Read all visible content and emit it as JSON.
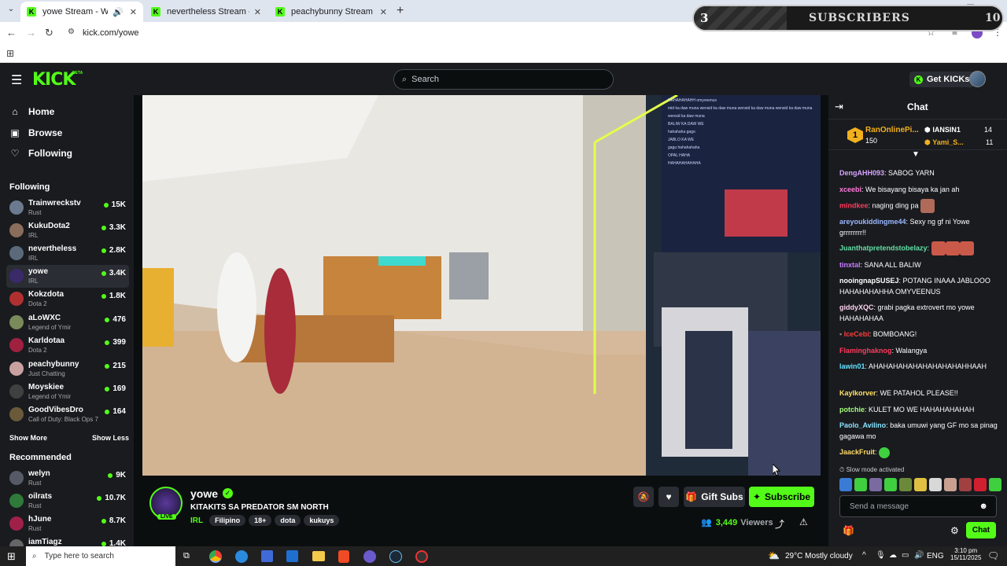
{
  "browser": {
    "tabs": [
      {
        "title": "yowe Stream - Watch Live o",
        "active": true
      },
      {
        "title": "nevertheless Stream - Watch Li",
        "active": false
      },
      {
        "title": "peachybunny Stream - Watch Li",
        "active": false
      }
    ],
    "url": "kick.com/yowe"
  },
  "overlay": {
    "count": "3",
    "label": "SUBSCRIBERS",
    "goal": "10",
    "progress": 0.3
  },
  "header": {
    "logo": "KICK",
    "beta": "BETA",
    "search_placeholder": "Search",
    "get_kicks": "Get KICKs"
  },
  "sidebar": {
    "nav": [
      {
        "label": "Home",
        "icon": "home-icon"
      },
      {
        "label": "Browse",
        "icon": "browse-icon"
      },
      {
        "label": "Following",
        "icon": "heart-icon"
      }
    ],
    "following_title": "Following",
    "following": [
      {
        "name": "Trainwreckstv",
        "game": "Rust",
        "viewers": "15K",
        "color": "#6b7a8f"
      },
      {
        "name": "KukuDota2",
        "game": "IRL",
        "viewers": "3.3K",
        "color": "#8a6d5a"
      },
      {
        "name": "nevertheless",
        "game": "IRL",
        "viewers": "2.8K",
        "color": "#5a6a7a"
      },
      {
        "name": "yowe",
        "game": "IRL",
        "viewers": "3.4K",
        "color": "#3a2a6a"
      },
      {
        "name": "Kokzdota",
        "game": "Dota 2",
        "viewers": "1.8K",
        "color": "#b03030"
      },
      {
        "name": "aLoWXC",
        "game": "Legend of Ymir",
        "viewers": "476",
        "color": "#7a8a5a"
      },
      {
        "name": "Karldotaa",
        "game": "Dota 2",
        "viewers": "399",
        "color": "#a02040"
      },
      {
        "name": "peachybunny",
        "game": "Just Chatting",
        "viewers": "215",
        "color": "#c9a0a0"
      },
      {
        "name": "Moyskiee",
        "game": "Legend of Ymir",
        "viewers": "169",
        "color": "#404040"
      },
      {
        "name": "GoodVibesDro",
        "game": "Call of Duty: Black Ops 7",
        "viewers": "164",
        "color": "#6a5a3a"
      }
    ],
    "show_more": "Show More",
    "show_less": "Show Less",
    "recommended_title": "Recommended",
    "recommended": [
      {
        "name": "welyn",
        "game": "Rust",
        "viewers": "9K",
        "color": "#555a66"
      },
      {
        "name": "oilrats",
        "game": "Rust",
        "viewers": "10.7K",
        "color": "#2f7a3a"
      },
      {
        "name": "hJune",
        "game": "Rust",
        "viewers": "8.7K",
        "color": "#a0204a"
      },
      {
        "name": "iamTiagz",
        "game": "",
        "viewers": "1.4K",
        "color": "#666"
      }
    ]
  },
  "stream": {
    "streamer": "yowe",
    "live": "LIVE",
    "title": "KITAKITS SA PREDATOR SM NORTH",
    "category": "IRL",
    "tags": [
      "Filipino",
      "18+",
      "dota",
      "kukuys"
    ],
    "gift_subs": "Gift Subs",
    "subscribe": "Subscribe",
    "viewers": "3,449",
    "viewers_label": "Viewers"
  },
  "chat": {
    "title": "Chat",
    "leaderboard": [
      {
        "rank": "1",
        "name": "RanOnlinePi...",
        "value": "150"
      },
      {
        "name": "IANSIN1",
        "value": "14"
      },
      {
        "name": "Yami_S...",
        "value": "11"
      }
    ],
    "messages": [
      {
        "user": "DengAHH093",
        "color": "#d8a5ff",
        "text": ": SABOG YARN"
      },
      {
        "user": "xceebi",
        "color": "#ff7ad9",
        "text": ": We bisayang bisaya ka jan ah"
      },
      {
        "user": "mindkee",
        "color": "#ff3b5c",
        "text": ": naging ding pa"
      },
      {
        "user": "areyoukiddingme44",
        "color": "#9bb7ff",
        "text": ": Sexy ng gf ni Yowe grrrrrrrr!!"
      },
      {
        "user": "Juanthatpretendstobelazy",
        "color": "#63e0a6",
        "text": ":"
      },
      {
        "user": "tinxtal",
        "color": "#c77dff",
        "text": ": SANA ALL BALIW"
      },
      {
        "user": "nooingnapSUSEJ",
        "color": "#ffffff",
        "text": ": POTANG INAAA JABLOOO HAHAHAHAHHA OMYVEENUS"
      },
      {
        "user": "giddyXQC",
        "color": "#ffd2f0",
        "text": ": grabi pagka extrovert mo yowe HAHAHAHAA"
      },
      {
        "user": "IceCebi",
        "color": "#ff3b3b",
        "text": ": BOMBOANG!"
      },
      {
        "user": "Flaminghaknog",
        "color": "#ff3b5c",
        "text": ": Walangya"
      },
      {
        "user": "lawin01",
        "color": "#63e0ff",
        "text": ": AHAHAHAHAHAHAHAHAHAHHAAH"
      },
      {
        "user": "Kaylkorver",
        "color": "#ffe066",
        "text": ": WE PATAHOL PLEASE!!"
      },
      {
        "user": "potchie",
        "color": "#a6ff7a",
        "text": ": KULET MO WE HAHAHAHAHAH"
      },
      {
        "user": "Paolo_Avilino",
        "color": "#8ae3ff",
        "text": ": baka umuwi yang GF mo sa pinag gagawa mo"
      },
      {
        "user": "JaackFruit",
        "color": "#ffd966",
        "text": ":"
      }
    ],
    "slow_mode": "Slow mode activated",
    "input_placeholder": "Send a message",
    "send_button": "Chat"
  },
  "video_overlay_chat": [
    "HAHAHAHAHH omyveenus",
    "mid ka daw muna wensid ka daw muna wensid ka daw muna wensid ka daw muna wensid ka daw muna",
    "BALIW KA DAW WE",
    "hahahaha gago",
    "JABLO KA WE",
    "gagu hahahahaha",
    "OPAL HAHA",
    "HAHAHAHAHAHA"
  ],
  "taskbar": {
    "search_placeholder": "Type here to search",
    "weather": "29°C  Mostly cloudy",
    "lang": "ENG",
    "time": "3:10 pm",
    "date": "15/11/2025"
  }
}
